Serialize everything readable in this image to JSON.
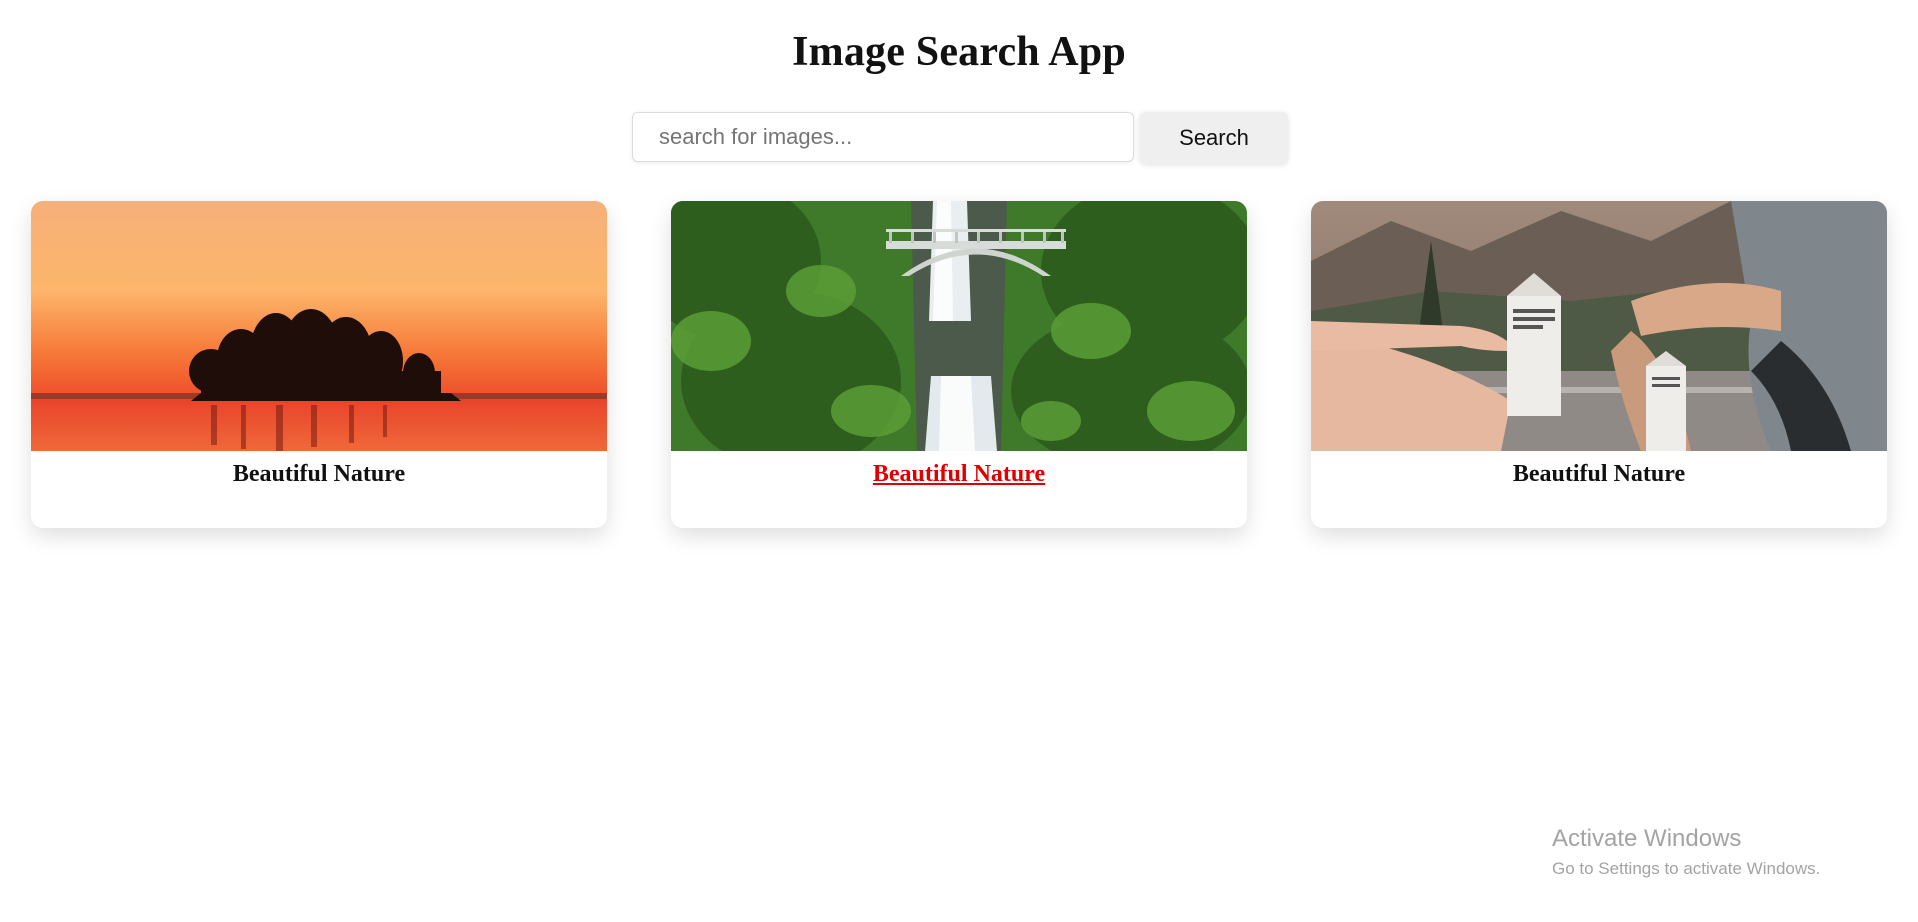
{
  "header": {
    "title": "Image Search App"
  },
  "search": {
    "placeholder": "search for images...",
    "value": "",
    "button_label": "Search"
  },
  "results": [
    {
      "title": "Beautiful Nature",
      "image": "sunset-lake-island-trees",
      "hovered": false
    },
    {
      "title": "Beautiful Nature",
      "image": "waterfall-bridge-forest",
      "hovered": true
    },
    {
      "title": "Beautiful Nature",
      "image": "people-holding-water-cartons-mountains",
      "hovered": false
    }
  ],
  "watermark": {
    "title": "Activate Windows",
    "subtitle": "Go to Settings to activate Windows."
  },
  "colors": {
    "hover_link": "#e00000",
    "button_bg": "#efefef",
    "text": "#111111"
  }
}
